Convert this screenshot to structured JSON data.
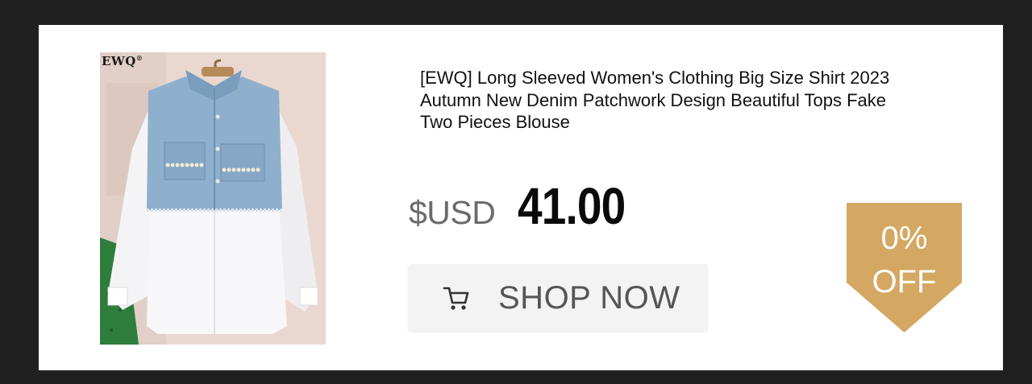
{
  "product": {
    "brand_mark": "EWQ",
    "brand_mark_symbol": "®",
    "title": "[EWQ] Long Sleeved Women's Clothing Big Size Shirt 2023 Autumn New Denim Patchwork Design Beautiful Tops Fake Two Pieces Blouse",
    "image_alt": "Denim patchwork white shirt with pearl-trimmed pockets"
  },
  "price": {
    "currency": "$USD",
    "amount": "41.00"
  },
  "actions": {
    "shop_now_label": "SHOP NOW",
    "cart_icon": "shopping-cart-icon"
  },
  "discount": {
    "percent": "0%",
    "label": "OFF",
    "color": "#d4a862"
  },
  "colors": {
    "page_background": "#202020",
    "card_background": "#ffffff",
    "button_background": "#f3f3f3"
  }
}
